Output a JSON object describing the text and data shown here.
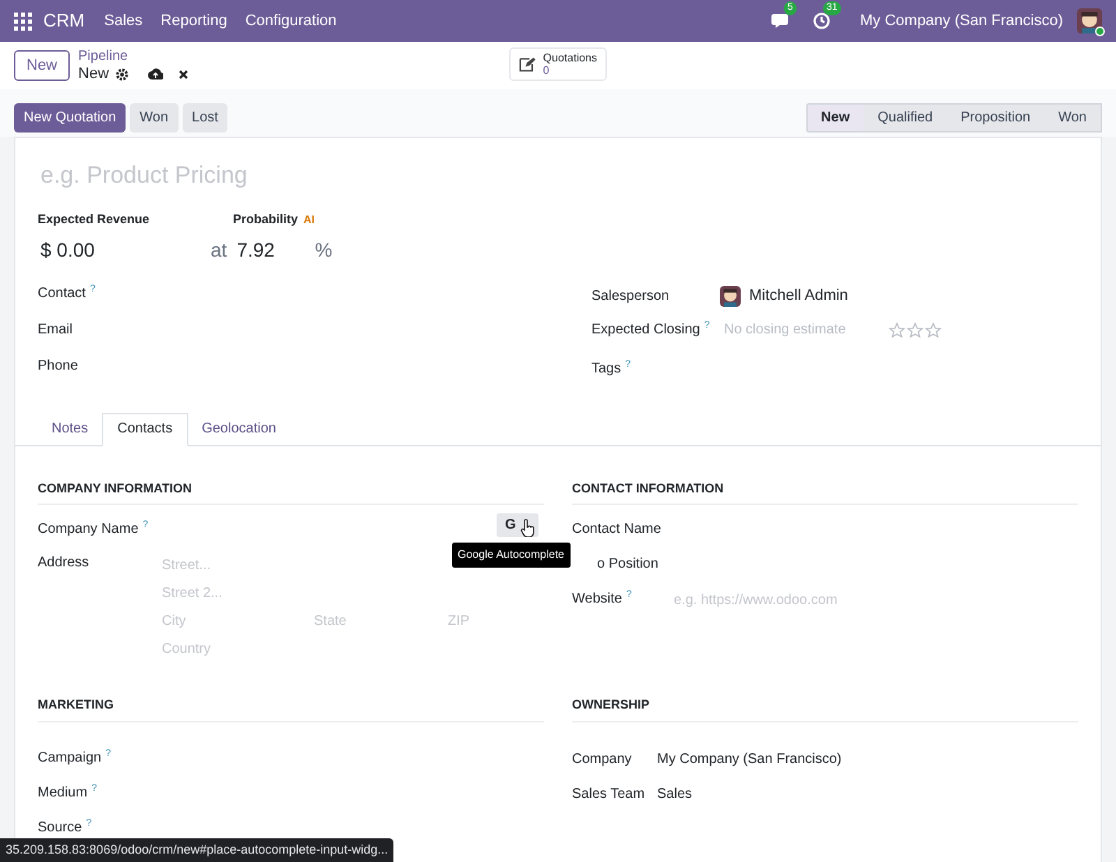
{
  "navbar": {
    "app": "CRM",
    "menu": [
      "Sales",
      "Reporting",
      "Configuration"
    ],
    "messages_badge": "5",
    "activities_badge": "31",
    "company": "My Company (San Francisco)"
  },
  "control_panel": {
    "new_button": "New",
    "breadcrumb": "Pipeline",
    "record": "New",
    "smart_button": {
      "label": "Quotations",
      "value": "0"
    }
  },
  "actions": [
    {
      "label": "New Quotation",
      "kind": "primary"
    },
    {
      "label": "Won",
      "kind": "secondary"
    },
    {
      "label": "Lost",
      "kind": "secondary"
    }
  ],
  "stages": [
    {
      "label": "New",
      "selected": true
    },
    {
      "label": "Qualified",
      "selected": false
    },
    {
      "label": "Proposition",
      "selected": false
    },
    {
      "label": "Won",
      "selected": false
    }
  ],
  "title": {
    "placeholder": "e.g. Product Pricing"
  },
  "revenue": {
    "label": "Expected Revenue",
    "value": "$ 0.00",
    "at": "at"
  },
  "probability": {
    "label": "Probability",
    "ai": "AI",
    "value": "7.92",
    "unit": "%"
  },
  "left_fields": [
    {
      "label": "Contact",
      "help": "?"
    },
    {
      "label": "Email"
    },
    {
      "label": "Phone"
    }
  ],
  "salesperson": {
    "label": "Salesperson",
    "value": "Mitchell Admin"
  },
  "expected_closing": {
    "label": "Expected Closing",
    "help": "?",
    "placeholder": "No closing estimate",
    "stars": 0
  },
  "tags": {
    "label": "Tags",
    "help": "?"
  },
  "tabs": [
    {
      "label": "Notes",
      "selected": false
    },
    {
      "label": "Contacts",
      "selected": true
    },
    {
      "label": "Geolocation",
      "selected": false
    }
  ],
  "company_info": {
    "heading": "COMPANY INFORMATION",
    "company_name": {
      "label": "Company Name",
      "help": "?"
    },
    "google_button": "G",
    "tooltip": "Google Autocomplete",
    "address": {
      "label": "Address",
      "street_placeholder": "Street...",
      "street2_placeholder": "Street 2...",
      "city_placeholder": "City",
      "state_placeholder": "State",
      "zip_placeholder": "ZIP",
      "country_placeholder": "Country"
    }
  },
  "contact_info": {
    "heading": "CONTACT INFORMATION",
    "fields": [
      {
        "label": "Contact Name"
      },
      {
        "label": "o Position"
      },
      {
        "label": "Website",
        "help": "?",
        "placeholder": "e.g. https://www.odoo.com"
      }
    ]
  },
  "marketing": {
    "heading": "MARKETING",
    "fields": [
      {
        "label": "Campaign",
        "help": "?"
      },
      {
        "label": "Medium",
        "help": "?"
      },
      {
        "label": "Source",
        "help": "?"
      }
    ]
  },
  "ownership": {
    "heading": "OWNERSHIP",
    "fields": [
      {
        "label": "Company",
        "value": "My Company (San Francisco)"
      },
      {
        "label": "Sales Team",
        "value": "Sales"
      }
    ]
  },
  "status_url": "35.209.158.83:8069/odoo/crm/new#place-autocomplete-input-widg..."
}
